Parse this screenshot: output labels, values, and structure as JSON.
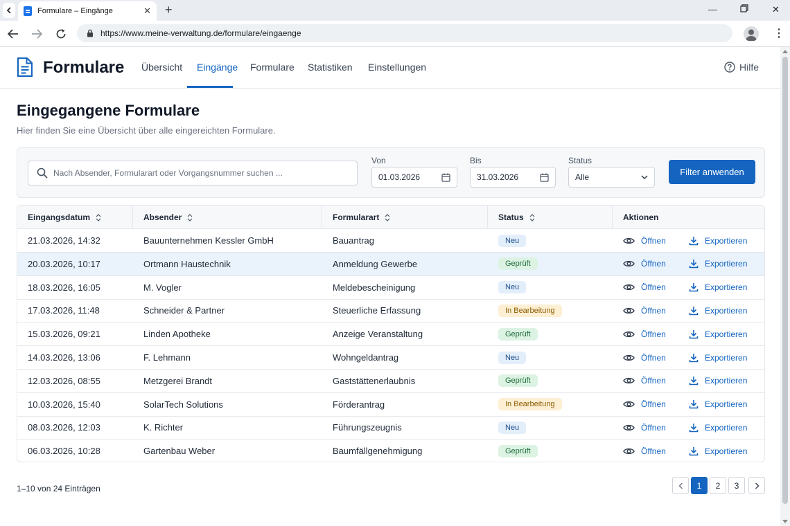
{
  "browser": {
    "tab_title": "Formulare – Eingänge",
    "url": "https://www.meine-verwaltung.de/formulare/eingaenge"
  },
  "app": {
    "brand": "Formulare",
    "nav": [
      {
        "label": "Übersicht"
      },
      {
        "label": "Eingänge",
        "active": true
      },
      {
        "label": "Formulare"
      },
      {
        "label": "Statistiken"
      },
      {
        "label": "Einstellungen"
      }
    ],
    "help_label": "Hilfe"
  },
  "page": {
    "title": "Eingegangene Formulare",
    "subtitle": "Hier finden Sie eine Übersicht über alle eingereichten Formulare."
  },
  "filters": {
    "search_placeholder": "Nach Absender, Formularart oder Vorgangsnummer suchen ...",
    "from_label": "Von",
    "from_value": "01.03.2026",
    "to_label": "Bis",
    "to_value": "31.03.2026",
    "status_label": "Status",
    "status_value": "Alle",
    "apply_label": "Filter anwenden"
  },
  "table": {
    "columns": [
      "Eingangsdatum",
      "Absender",
      "Formularart",
      "Status",
      "Aktionen"
    ],
    "open_label": "Öffnen",
    "export_label": "Exportieren",
    "rows": [
      {
        "date": "21.03.2026, 14:32",
        "sender": "Bauunternehmen Kessler GmbH",
        "type": "Bauantrag",
        "status": "Neu"
      },
      {
        "date": "20.03.2026, 10:17",
        "sender": "Ortmann Haustechnik",
        "type": "Anmeldung Gewerbe",
        "status": "Geprüft"
      },
      {
        "date": "18.03.2026, 16:05",
        "sender": "M. Vogler",
        "type": "Meldebescheinigung",
        "status": "Neu"
      },
      {
        "date": "17.03.2026, 11:48",
        "sender": "Schneider & Partner",
        "type": "Steuerliche Erfassung",
        "status": "In Bearbeitung"
      },
      {
        "date": "15.03.2026, 09:21",
        "sender": "Linden Apotheke",
        "type": "Anzeige Veranstaltung",
        "status": "Geprüft"
      },
      {
        "date": "14.03.2026, 13:06",
        "sender": "F. Lehmann",
        "type": "Wohngeldantrag",
        "status": "Neu"
      },
      {
        "date": "12.03.2026, 08:55",
        "sender": "Metzgerei Brandt",
        "type": "Gaststättenerlaubnis",
        "status": "Geprüft"
      },
      {
        "date": "10.03.2026, 15:40",
        "sender": "SolarTech Solutions",
        "type": "Förderantrag",
        "status": "In Bearbeitung"
      },
      {
        "date": "08.03.2026, 12:03",
        "sender": "K. Richter",
        "type": "Führungszeugnis",
        "status": "Neu"
      },
      {
        "date": "06.03.2026, 10:28",
        "sender": "Gartenbau Weber",
        "type": "Baumfällgenehmigung",
        "status": "Geprüft"
      }
    ]
  },
  "status_colors": {
    "Neu": {
      "bg": "#e3eefb",
      "fg": "#1e4e8c"
    },
    "Geprüft": {
      "bg": "#dcf3e3",
      "fg": "#1e6b3a"
    },
    "In Bearbeitung": {
      "bg": "#fdefd3",
      "fg": "#8a5a00"
    }
  },
  "pagination": {
    "summary": "1–10 von 24 Einträgen",
    "pages": [
      "1",
      "2",
      "3"
    ],
    "current": "1"
  },
  "colors": {
    "accent": "#1565c0"
  }
}
